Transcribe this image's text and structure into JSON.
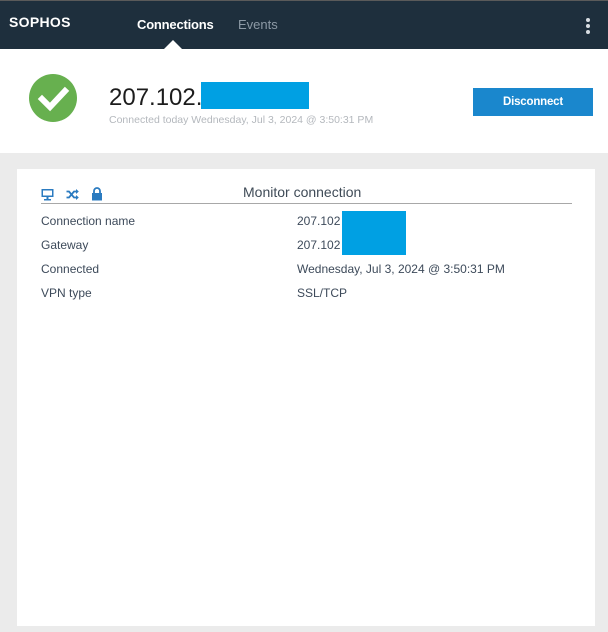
{
  "header": {
    "logo": "SOPHOS",
    "tabs": [
      {
        "label": "Connections",
        "active": true
      },
      {
        "label": "Events",
        "active": false
      }
    ],
    "menu_icon": "kebab-vertical-icon"
  },
  "status": {
    "icon": "check-circle-icon",
    "icon_color": "#67b04f",
    "title": "207.102.",
    "subtitle": "Connected today Wednesday, Jul 3, 2024 @ 3:50:31 PM",
    "redacted_color": "#00a0e3",
    "disconnect_label": "Disconnect",
    "button_color": "#1a87cd"
  },
  "monitor": {
    "icons": [
      "monitor-icon",
      "shuffle-icon",
      "lock-icon"
    ],
    "icon_color": "#2b7bc0",
    "title": "Monitor connection",
    "rows": [
      {
        "label": "Connection name",
        "value": "207.102"
      },
      {
        "label": "Gateway",
        "value": "207.102"
      },
      {
        "label": "Connected",
        "value": "Wednesday, Jul 3, 2024 @ 3:50:31 PM"
      },
      {
        "label": "VPN type",
        "value": "SSL/TCP"
      }
    ]
  }
}
